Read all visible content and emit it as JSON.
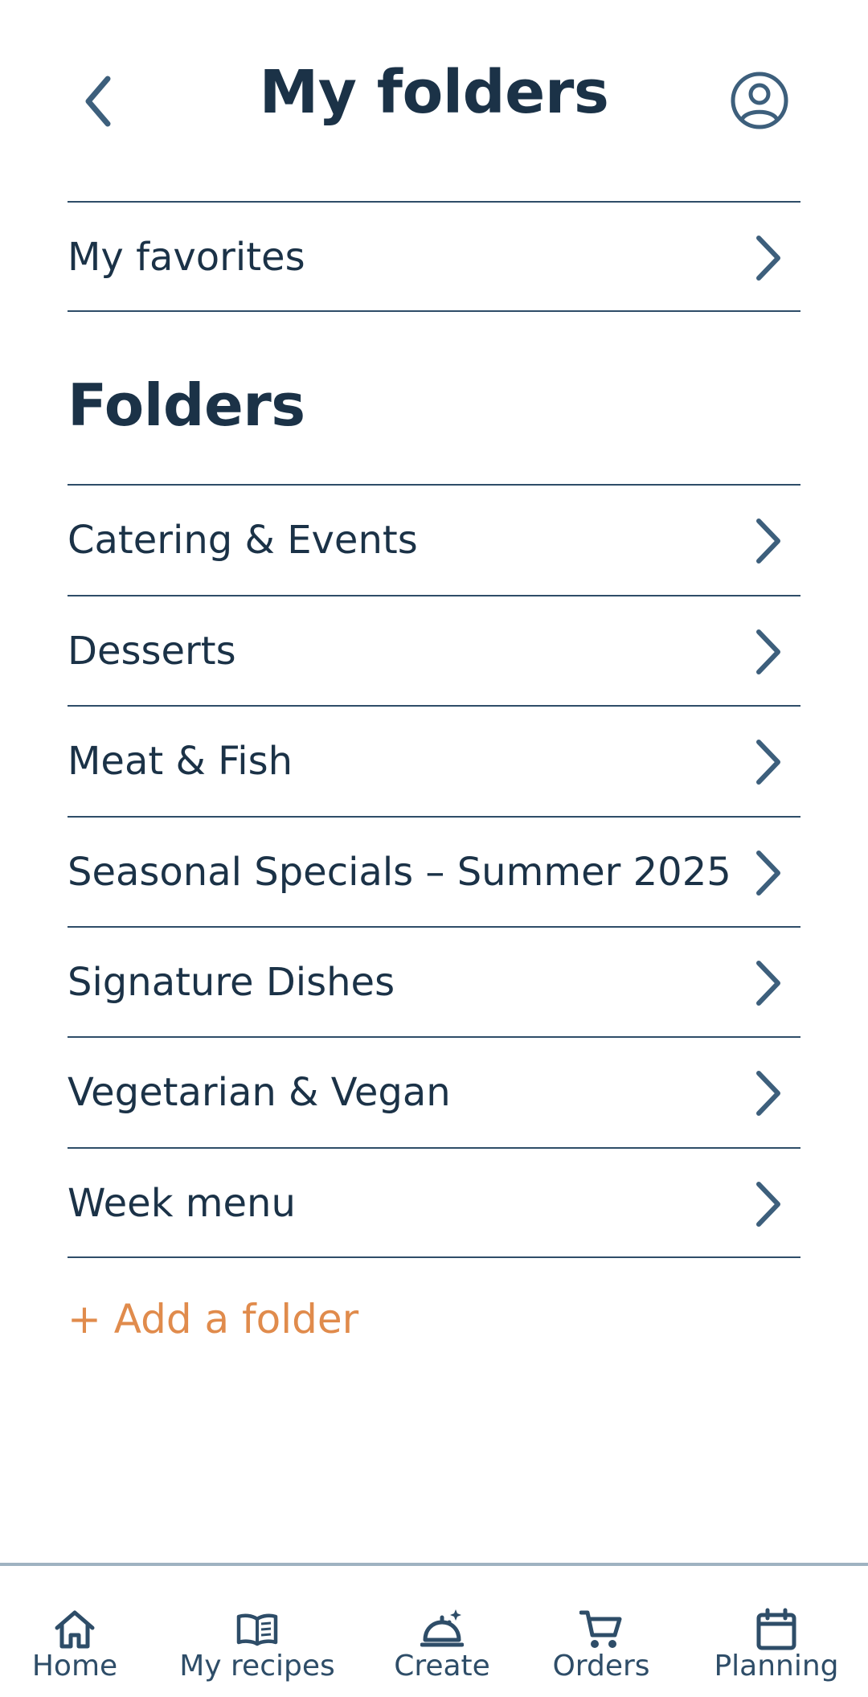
{
  "header": {
    "title": "My folders",
    "back_icon": "chevron-left-icon",
    "profile_icon": "user-circle-icon"
  },
  "favorites": {
    "label": "My favorites"
  },
  "folders_section": {
    "title": "Folders",
    "items": [
      {
        "label": "Catering & Events"
      },
      {
        "label": "Desserts"
      },
      {
        "label": "Meat & Fish"
      },
      {
        "label": "Seasonal Specials – Summer 2025"
      },
      {
        "label": "Signature Dishes"
      },
      {
        "label": "Vegetarian & Vegan"
      },
      {
        "label": "Week menu"
      }
    ],
    "add_label": "+ Add a folder"
  },
  "bottom_nav": {
    "items": [
      {
        "label": "Home",
        "icon": "home-icon"
      },
      {
        "label": "My recipes",
        "icon": "open-book-icon"
      },
      {
        "label": "Create",
        "icon": "cloche-sparkle-icon"
      },
      {
        "label": "Orders",
        "icon": "cart-icon"
      },
      {
        "label": "Planning",
        "icon": "calendar-icon"
      }
    ]
  },
  "colors": {
    "text": "#1b3247",
    "line": "#2e4d68",
    "icon": "#3d5f7c",
    "accent": "#e08b4c",
    "nav_border": "#9fb2c1"
  }
}
